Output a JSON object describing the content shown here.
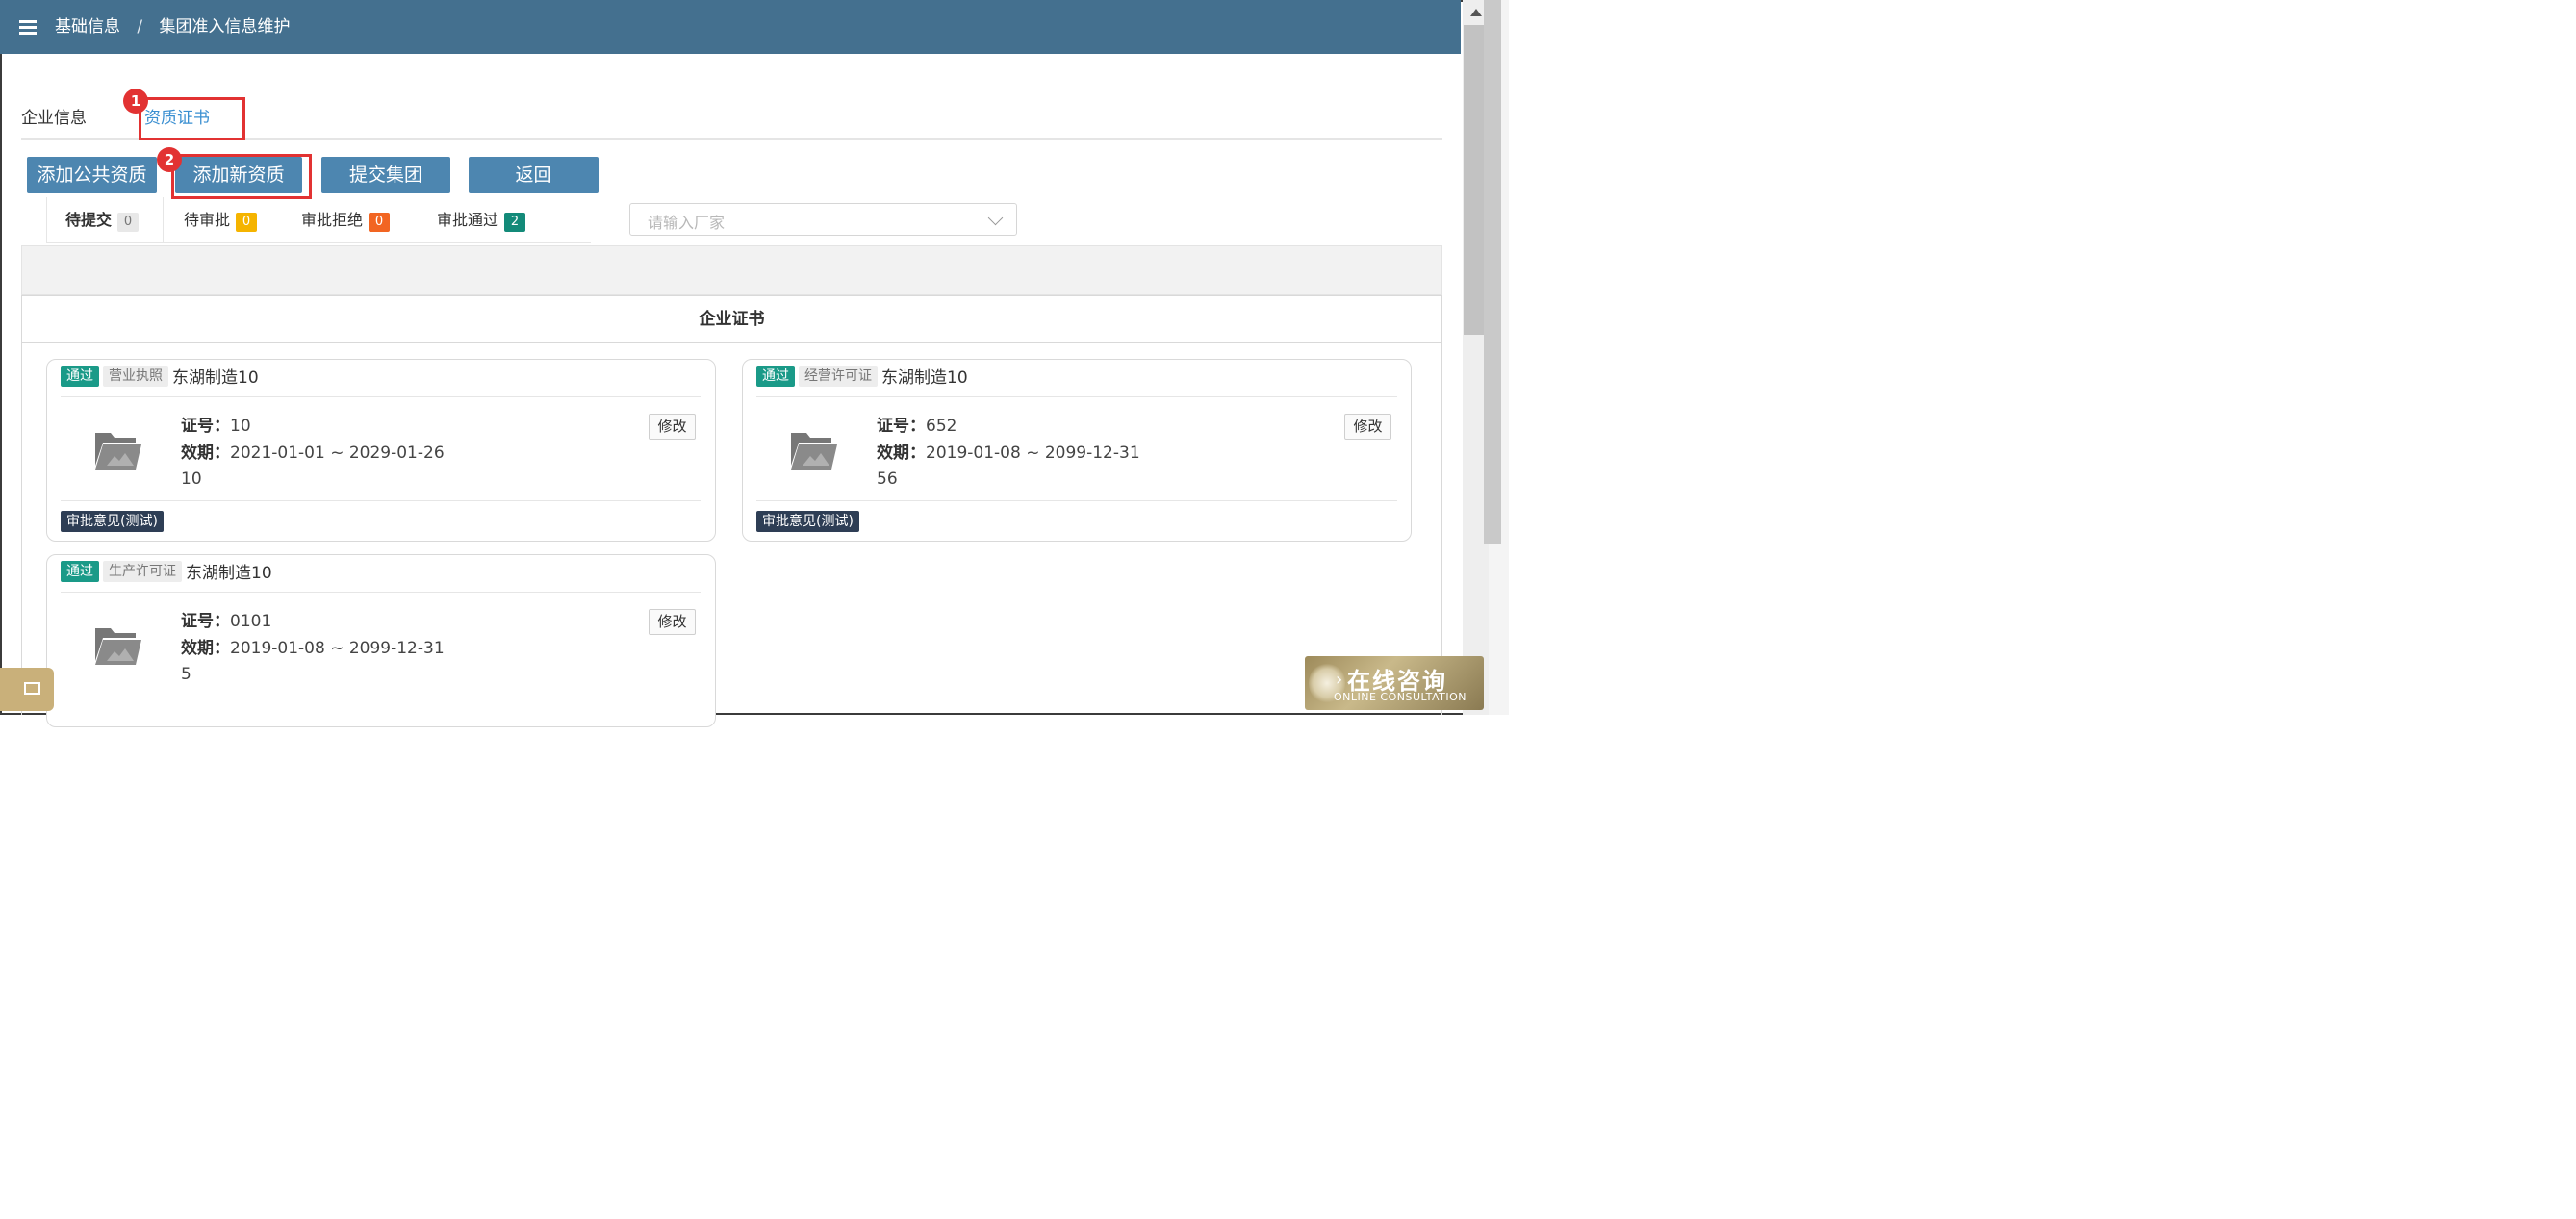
{
  "header": {
    "breadcrumb": [
      "基础信息",
      "集团准入信息维护"
    ],
    "separator": "/"
  },
  "tabs": [
    {
      "label": "企业信息",
      "active": false
    },
    {
      "label": "资质证书",
      "active": true
    }
  ],
  "annotations": [
    "1",
    "2"
  ],
  "toolbar": {
    "buttons": [
      "添加公共资质",
      "添加新资质",
      "提交集团",
      "返回"
    ]
  },
  "status_tabs": [
    {
      "label": "待提交",
      "count": "0",
      "color": "#e8e8e8"
    },
    {
      "label": "待审批",
      "count": "0",
      "color": "#f5b400"
    },
    {
      "label": "审批拒绝",
      "count": "0",
      "color": "#f26522"
    },
    {
      "label": "审批通过",
      "count": "2",
      "color": "#138a79"
    }
  ],
  "manufacturer_select": {
    "placeholder": "请输入厂家"
  },
  "panel": {
    "title": "企业证书"
  },
  "labels": {
    "cert_no": "证号：",
    "validity": "效期：",
    "edit": "修改",
    "opinion": "审批意见(测试)"
  },
  "certificates": [
    {
      "status": "通过",
      "type": "营业执照",
      "company": "东湖制造10",
      "cert_no": "10",
      "validity": "2021-01-01 ~ 2029-01-26",
      "note": "10"
    },
    {
      "status": "通过",
      "type": "经营许可证",
      "company": "东湖制造10",
      "cert_no": "652",
      "validity": "2019-01-08 ~ 2099-12-31",
      "note": "56"
    },
    {
      "status": "通过",
      "type": "生产许可证",
      "company": "东湖制造10",
      "cert_no": "0101",
      "validity": "2019-01-08 ~ 2099-12-31",
      "note": "5"
    }
  ],
  "consult_widget": {
    "title": "在线咨询",
    "subtitle": "ONLINE CONSULTATION"
  },
  "colors": {
    "header": "#44708f",
    "button": "#4d86b0",
    "pass_tag": "#1a9a88",
    "opinion_tag": "#2e3e55",
    "annotation": "#e23232",
    "active_tab": "#3a8fd1"
  }
}
